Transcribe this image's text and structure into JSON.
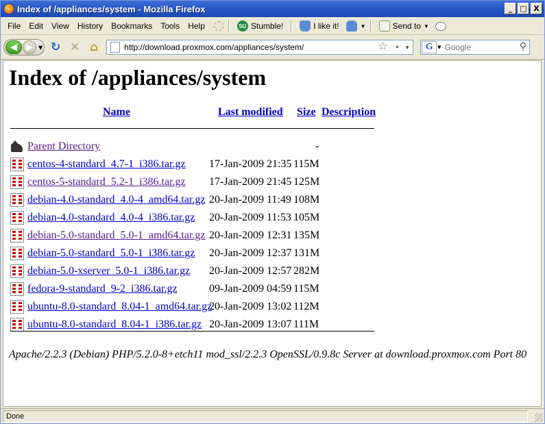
{
  "window": {
    "title": "Index of /appliances/system - Mozilla Firefox",
    "minimize_glyph": "_",
    "maximize_glyph": "□",
    "close_glyph": "X"
  },
  "menubar": {
    "items": [
      "File",
      "Edit",
      "View",
      "History",
      "Bookmarks",
      "Tools",
      "Help"
    ],
    "toolbar": {
      "stumble_label": "Stumble!",
      "like_label": "I like it!",
      "send_to_label": "Send to"
    }
  },
  "navbar": {
    "url": "http://download.proxmox.com/appliances/system/",
    "search_placeholder": "Google",
    "search_engine_glyph": "G"
  },
  "page": {
    "heading": "Index of /appliances/system",
    "columns": {
      "name": "Name",
      "last_modified": "Last modified",
      "size": "Size",
      "description": "Description"
    },
    "parent": {
      "label": "Parent Directory",
      "size": "-"
    },
    "files": [
      {
        "name": "centos-4-standard_4.7-1_i386.tar.gz",
        "modified": "17-Jan-2009 21:35",
        "size": "115M",
        "visited": false
      },
      {
        "name": "centos-5-standard_5.2-1_i386.tar.gz",
        "modified": "17-Jan-2009 21:45",
        "size": "125M",
        "visited": true
      },
      {
        "name": "debian-4.0-standard_4.0-4_amd64.tar.gz",
        "modified": "20-Jan-2009 11:49",
        "size": "108M",
        "visited": false
      },
      {
        "name": "debian-4.0-standard_4.0-4_i386.tar.gz",
        "modified": "20-Jan-2009 11:53",
        "size": "105M",
        "visited": false
      },
      {
        "name": "debian-5.0-standard_5.0-1_amd64.tar.gz",
        "modified": "20-Jan-2009 12:31",
        "size": "135M",
        "visited": true
      },
      {
        "name": "debian-5.0-standard_5.0-1_i386.tar.gz",
        "modified": "20-Jan-2009 12:37",
        "size": "131M",
        "visited": false
      },
      {
        "name": "debian-5.0-xserver_5.0-1_i386.tar.gz",
        "modified": "20-Jan-2009 12:57",
        "size": "282M",
        "visited": false
      },
      {
        "name": "fedora-9-standard_9-2_i386.tar.gz",
        "modified": "09-Jan-2009 04:59",
        "size": "115M",
        "visited": false
      },
      {
        "name": "ubuntu-8.0-standard_8.04-1_amd64.tar.gz",
        "modified": "20-Jan-2009 13:02",
        "size": "112M",
        "visited": false
      },
      {
        "name": "ubuntu-8.0-standard_8.04-1_i386.tar.gz",
        "modified": "20-Jan-2009 13:07",
        "size": "111M",
        "visited": false
      }
    ],
    "address": "Apache/2.2.3 (Debian) PHP/5.2.0-8+etch11 mod_ssl/2.2.3 OpenSSL/0.9.8c Server at download.proxmox.com Port 80"
  },
  "statusbar": {
    "text": "Done"
  },
  "colors": {
    "link": "#0000cc",
    "visited_link": "#551a8b",
    "titlebar": "#2a5bc9",
    "chrome": "#ece9d8"
  }
}
